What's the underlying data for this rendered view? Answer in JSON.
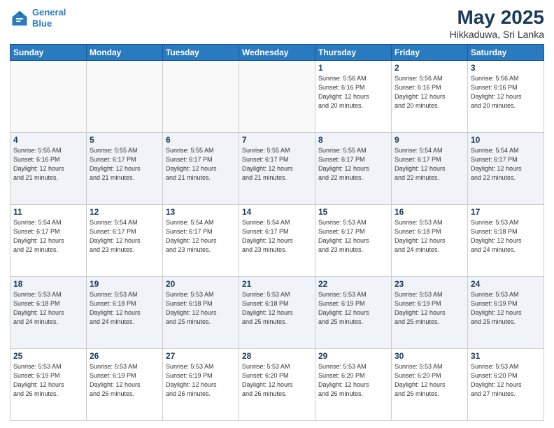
{
  "logo": {
    "line1": "General",
    "line2": "Blue"
  },
  "title": "May 2025",
  "subtitle": "Hikkaduwa, Sri Lanka",
  "days_of_week": [
    "Sunday",
    "Monday",
    "Tuesday",
    "Wednesday",
    "Thursday",
    "Friday",
    "Saturday"
  ],
  "weeks": [
    [
      {
        "day": "",
        "info": ""
      },
      {
        "day": "",
        "info": ""
      },
      {
        "day": "",
        "info": ""
      },
      {
        "day": "",
        "info": ""
      },
      {
        "day": "1",
        "info": "Sunrise: 5:56 AM\nSunset: 6:16 PM\nDaylight: 12 hours\nand 20 minutes."
      },
      {
        "day": "2",
        "info": "Sunrise: 5:56 AM\nSunset: 6:16 PM\nDaylight: 12 hours\nand 20 minutes."
      },
      {
        "day": "3",
        "info": "Sunrise: 5:56 AM\nSunset: 6:16 PM\nDaylight: 12 hours\nand 20 minutes."
      }
    ],
    [
      {
        "day": "4",
        "info": "Sunrise: 5:55 AM\nSunset: 6:16 PM\nDaylight: 12 hours\nand 21 minutes."
      },
      {
        "day": "5",
        "info": "Sunrise: 5:55 AM\nSunset: 6:17 PM\nDaylight: 12 hours\nand 21 minutes."
      },
      {
        "day": "6",
        "info": "Sunrise: 5:55 AM\nSunset: 6:17 PM\nDaylight: 12 hours\nand 21 minutes."
      },
      {
        "day": "7",
        "info": "Sunrise: 5:55 AM\nSunset: 6:17 PM\nDaylight: 12 hours\nand 21 minutes."
      },
      {
        "day": "8",
        "info": "Sunrise: 5:55 AM\nSunset: 6:17 PM\nDaylight: 12 hours\nand 22 minutes."
      },
      {
        "day": "9",
        "info": "Sunrise: 5:54 AM\nSunset: 6:17 PM\nDaylight: 12 hours\nand 22 minutes."
      },
      {
        "day": "10",
        "info": "Sunrise: 5:54 AM\nSunset: 6:17 PM\nDaylight: 12 hours\nand 22 minutes."
      }
    ],
    [
      {
        "day": "11",
        "info": "Sunrise: 5:54 AM\nSunset: 6:17 PM\nDaylight: 12 hours\nand 22 minutes."
      },
      {
        "day": "12",
        "info": "Sunrise: 5:54 AM\nSunset: 6:17 PM\nDaylight: 12 hours\nand 23 minutes."
      },
      {
        "day": "13",
        "info": "Sunrise: 5:54 AM\nSunset: 6:17 PM\nDaylight: 12 hours\nand 23 minutes."
      },
      {
        "day": "14",
        "info": "Sunrise: 5:54 AM\nSunset: 6:17 PM\nDaylight: 12 hours\nand 23 minutes."
      },
      {
        "day": "15",
        "info": "Sunrise: 5:53 AM\nSunset: 6:17 PM\nDaylight: 12 hours\nand 23 minutes."
      },
      {
        "day": "16",
        "info": "Sunrise: 5:53 AM\nSunset: 6:18 PM\nDaylight: 12 hours\nand 24 minutes."
      },
      {
        "day": "17",
        "info": "Sunrise: 5:53 AM\nSunset: 6:18 PM\nDaylight: 12 hours\nand 24 minutes."
      }
    ],
    [
      {
        "day": "18",
        "info": "Sunrise: 5:53 AM\nSunset: 6:18 PM\nDaylight: 12 hours\nand 24 minutes."
      },
      {
        "day": "19",
        "info": "Sunrise: 5:53 AM\nSunset: 6:18 PM\nDaylight: 12 hours\nand 24 minutes."
      },
      {
        "day": "20",
        "info": "Sunrise: 5:53 AM\nSunset: 6:18 PM\nDaylight: 12 hours\nand 25 minutes."
      },
      {
        "day": "21",
        "info": "Sunrise: 5:53 AM\nSunset: 6:18 PM\nDaylight: 12 hours\nand 25 minutes."
      },
      {
        "day": "22",
        "info": "Sunrise: 5:53 AM\nSunset: 6:19 PM\nDaylight: 12 hours\nand 25 minutes."
      },
      {
        "day": "23",
        "info": "Sunrise: 5:53 AM\nSunset: 6:19 PM\nDaylight: 12 hours\nand 25 minutes."
      },
      {
        "day": "24",
        "info": "Sunrise: 5:53 AM\nSunset: 6:19 PM\nDaylight: 12 hours\nand 25 minutes."
      }
    ],
    [
      {
        "day": "25",
        "info": "Sunrise: 5:53 AM\nSunset: 6:19 PM\nDaylight: 12 hours\nand 26 minutes."
      },
      {
        "day": "26",
        "info": "Sunrise: 5:53 AM\nSunset: 6:19 PM\nDaylight: 12 hours\nand 26 minutes."
      },
      {
        "day": "27",
        "info": "Sunrise: 5:53 AM\nSunset: 6:19 PM\nDaylight: 12 hours\nand 26 minutes."
      },
      {
        "day": "28",
        "info": "Sunrise: 5:53 AM\nSunset: 6:20 PM\nDaylight: 12 hours\nand 26 minutes."
      },
      {
        "day": "29",
        "info": "Sunrise: 5:53 AM\nSunset: 6:20 PM\nDaylight: 12 hours\nand 26 minutes."
      },
      {
        "day": "30",
        "info": "Sunrise: 5:53 AM\nSunset: 6:20 PM\nDaylight: 12 hours\nand 26 minutes."
      },
      {
        "day": "31",
        "info": "Sunrise: 5:53 AM\nSunset: 6:20 PM\nDaylight: 12 hours\nand 27 minutes."
      }
    ]
  ]
}
